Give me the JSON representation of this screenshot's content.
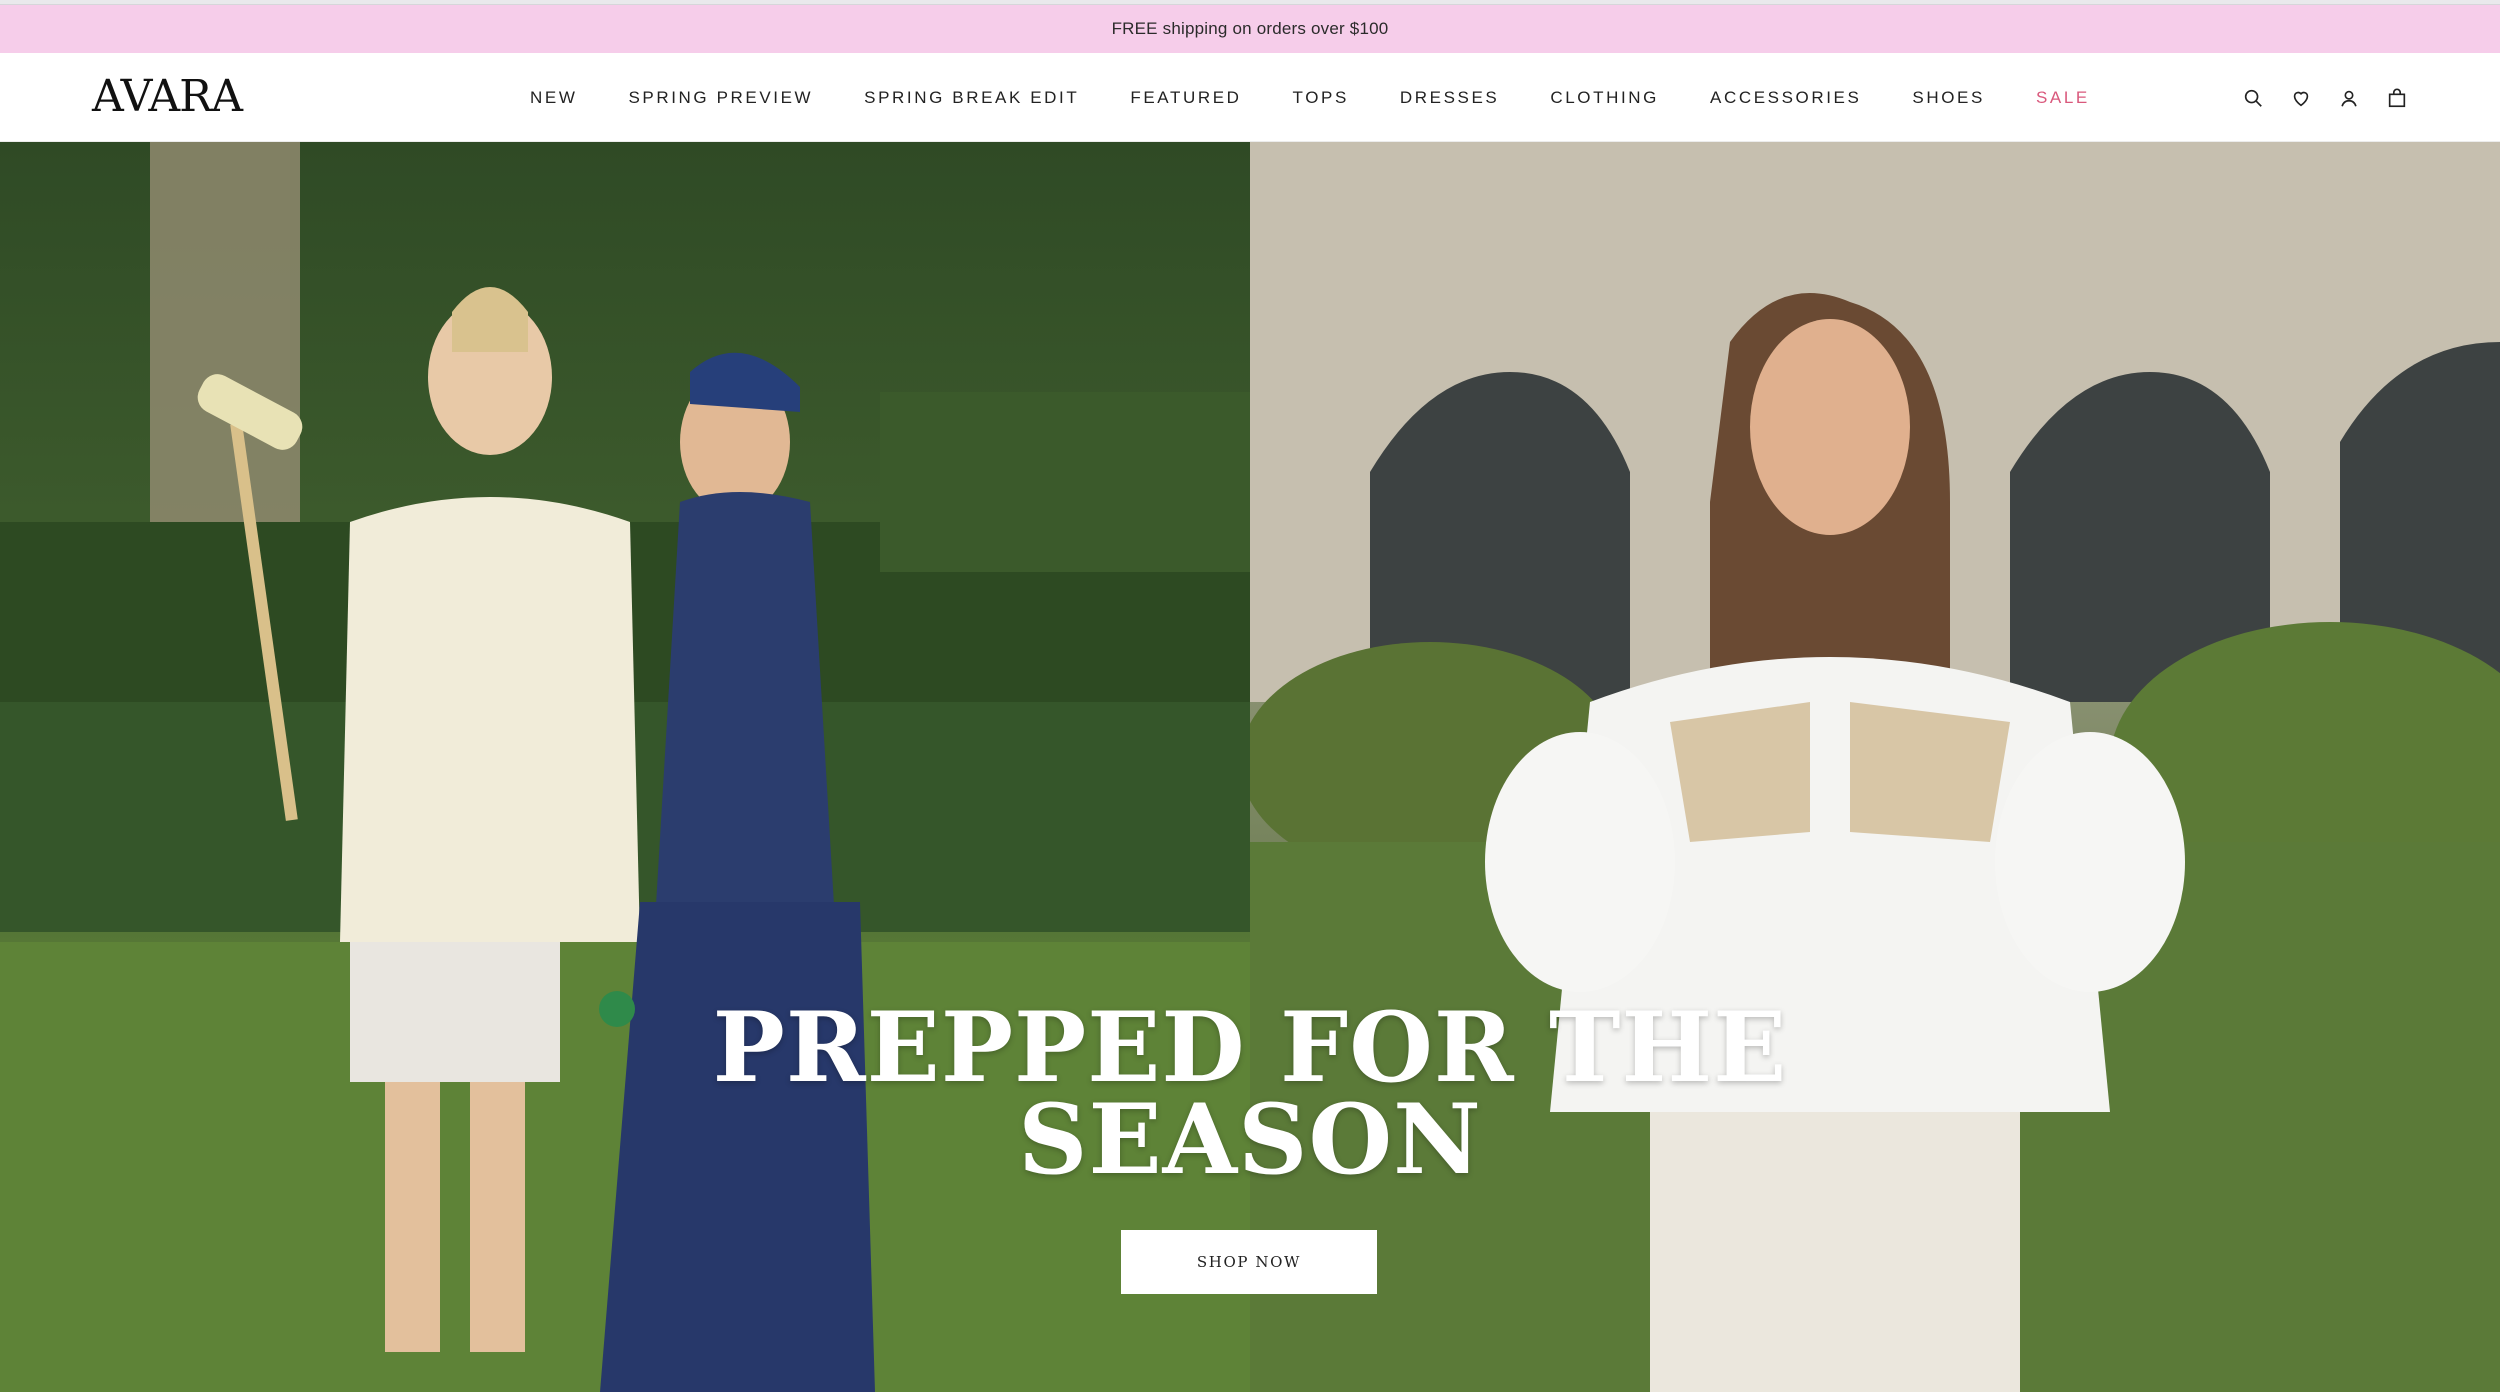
{
  "announcement": {
    "text": "FREE shipping on orders over $100"
  },
  "header": {
    "logo": "AVARA",
    "nav": [
      {
        "label": "NEW"
      },
      {
        "label": "SPRING PREVIEW"
      },
      {
        "label": "SPRING BREAK EDIT"
      },
      {
        "label": "FEATURED"
      },
      {
        "label": "TOPS"
      },
      {
        "label": "DRESSES"
      },
      {
        "label": "CLOTHING"
      },
      {
        "label": "ACCESSORIES"
      },
      {
        "label": "SHOES"
      },
      {
        "label": "SALE"
      }
    ],
    "icons": [
      "search-icon",
      "heart-icon",
      "account-icon",
      "bag-icon"
    ]
  },
  "hero": {
    "title_line1": "PREPPED FOR THE",
    "title_line2": "SEASON",
    "cta_label": "SHOP NOW"
  },
  "colors": {
    "announcement_bg": "#f6cdea",
    "sale_accent": "#d9587c",
    "text": "#222222"
  }
}
